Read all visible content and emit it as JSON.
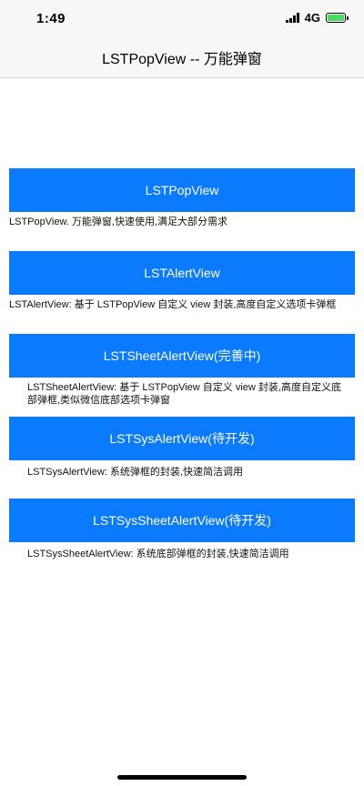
{
  "status_bar": {
    "time": "1:49",
    "network": "4G"
  },
  "nav": {
    "title": "LSTPopView -- 万能弹窗"
  },
  "items": [
    {
      "button_label": "LSTPopView",
      "description": "LSTPopView. 万能弹窗,快速使用,满足大部分需求"
    },
    {
      "button_label": "LSTAlertView",
      "description": "LSTAlertView: 基于 LSTPopView 自定义 view 封装,高度自定义选项卡弹框"
    },
    {
      "button_label": "LSTSheetAlertView(完善中)",
      "description": "LSTSheetAlertView: 基于 LSTPopView 自定义 view 封装,高度自定义底部弹框,类似微信底部选项卡弹窗"
    },
    {
      "button_label": "LSTSysAlertView(待开发)",
      "description": "LSTSysAlertView: 系统弹框的封装,快速简洁调用"
    },
    {
      "button_label": "LSTSysSheetAlertView(待开发)",
      "description": "LSTSysSheetAlertView: 系统底部弹框的封装,快速简洁调用"
    }
  ],
  "colors": {
    "accent": "#0a7aff",
    "battery": "#4cd964"
  }
}
